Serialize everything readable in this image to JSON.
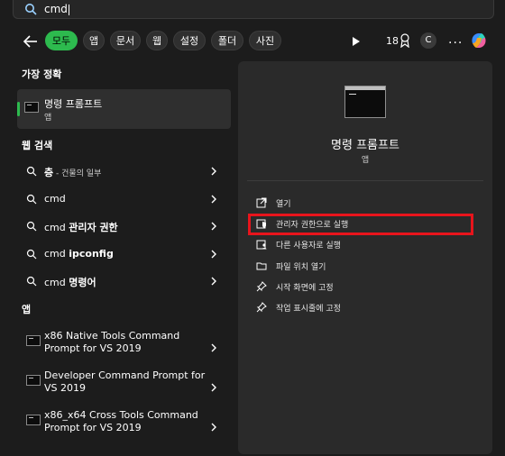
{
  "search": {
    "query": "cmd"
  },
  "filters": {
    "back_label": "←",
    "chips": [
      "모두",
      "앱",
      "문서",
      "웹",
      "설정",
      "폴더",
      "사진"
    ],
    "points": "18",
    "avatar_letter": "C",
    "more": "..."
  },
  "left": {
    "best_match_heading": "가장 정확",
    "best_match": {
      "title": "명령 프롬프트",
      "subtitle": "앱"
    },
    "web_heading": "웹 검색",
    "web_results": [
      {
        "bold": "층",
        "rest": " - 건물의 일부"
      },
      {
        "bold": "",
        "rest": "cmd"
      },
      {
        "bold": "관리자 권한",
        "prefix": "cmd "
      },
      {
        "bold": "ipconfig",
        "prefix": "cmd "
      },
      {
        "bold": "명령어",
        "prefix": "cmd "
      }
    ],
    "apps_heading": "앱",
    "apps": [
      {
        "line1": "x86 Native Tools Command",
        "line2": "Prompt for VS 2019"
      },
      {
        "line1": "Developer Command Prompt for",
        "line2": "VS 2019"
      },
      {
        "line1": "x86_x64 Cross Tools Command",
        "line2": "Prompt for VS 2019"
      }
    ]
  },
  "right": {
    "title": "명령 프롬프트",
    "subtitle": "앱",
    "actions": [
      {
        "label": "열기",
        "icon": "open-icon"
      },
      {
        "label": "관리자 권한으로 실행",
        "icon": "admin-shield-icon"
      },
      {
        "label": "다른 사용자로 실행",
        "icon": "user-icon"
      },
      {
        "label": "파일 위치 열기",
        "icon": "folder-icon"
      },
      {
        "label": "시작 화면에 고정",
        "icon": "pin-icon"
      },
      {
        "label": "작업 표시줄에 고정",
        "icon": "pin-icon"
      }
    ],
    "highlight_color": "#e8141c"
  },
  "colors": {
    "accent": "#2dba4e",
    "background": "#1c1c1c",
    "panel": "#2a2a2a"
  }
}
